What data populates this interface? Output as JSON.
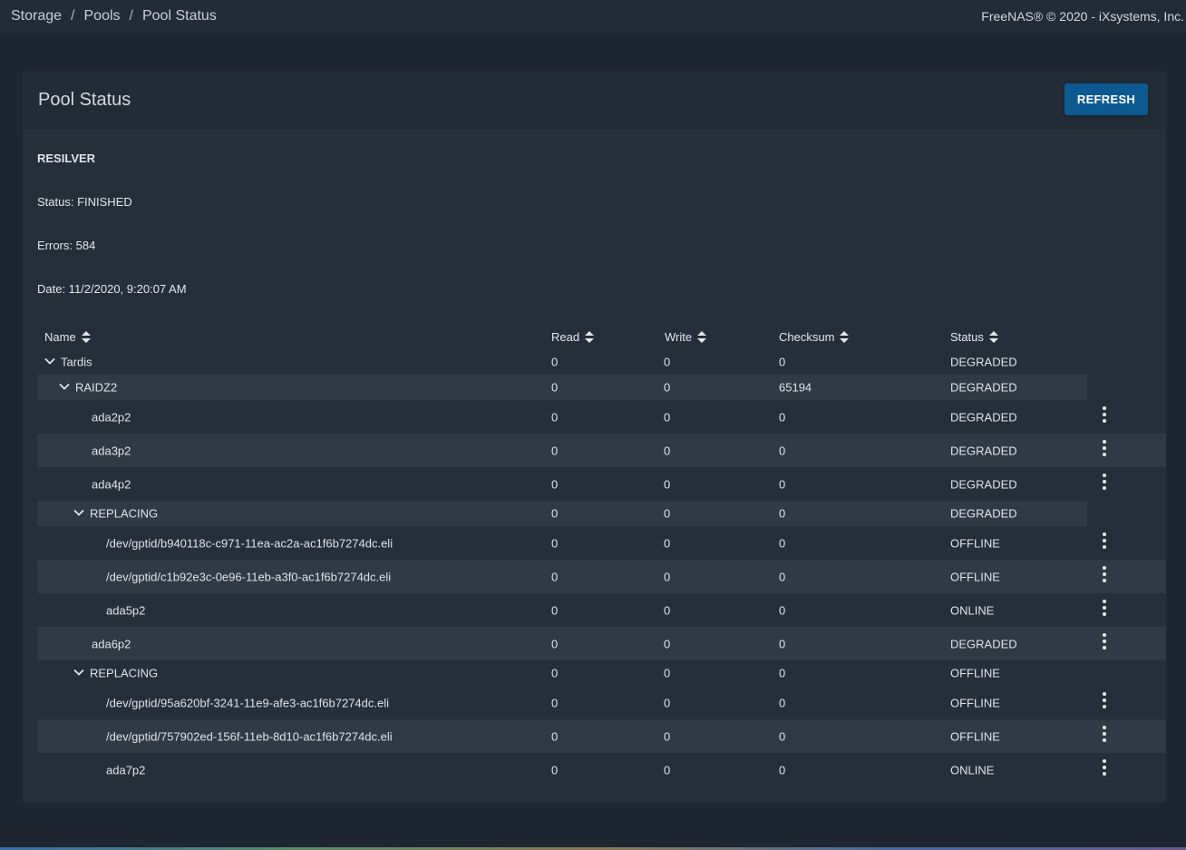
{
  "breadcrumb": {
    "items": [
      "Storage",
      "Pools",
      "Pool Status"
    ],
    "separator": "/"
  },
  "footer_notice": "FreeNAS® © 2020 - iXsystems, Inc.",
  "card": {
    "title": "Pool Status",
    "refresh_label": "REFRESH"
  },
  "scan": {
    "heading": "RESILVER",
    "status": "Status: FINISHED",
    "errors": "Errors: 584",
    "date": "Date: 11/2/2020, 9:20:07 AM"
  },
  "table": {
    "columns": [
      "Name",
      "Read",
      "Write",
      "Checksum",
      "Status"
    ],
    "rows": [
      {
        "name": "Tardis",
        "read": "0",
        "write": "0",
        "checksum": "0",
        "status": "DEGRADED",
        "kind": "group",
        "depth": 0
      },
      {
        "name": "RAIDZ2",
        "read": "0",
        "write": "0",
        "checksum": "65194",
        "status": "DEGRADED",
        "kind": "group",
        "depth": 1
      },
      {
        "name": "ada2p2",
        "read": "0",
        "write": "0",
        "checksum": "0",
        "status": "DEGRADED",
        "kind": "disk",
        "depth": 2
      },
      {
        "name": "ada3p2",
        "read": "0",
        "write": "0",
        "checksum": "0",
        "status": "DEGRADED",
        "kind": "disk",
        "depth": 2
      },
      {
        "name": "ada4p2",
        "read": "0",
        "write": "0",
        "checksum": "0",
        "status": "DEGRADED",
        "kind": "disk",
        "depth": 2
      },
      {
        "name": "REPLACING",
        "read": "0",
        "write": "0",
        "checksum": "0",
        "status": "DEGRADED",
        "kind": "group",
        "depth": 2
      },
      {
        "name": "/dev/gptid/b940118c-c971-11ea-ac2a-ac1f6b7274dc.eli",
        "read": "0",
        "write": "0",
        "checksum": "0",
        "status": "OFFLINE",
        "kind": "disk",
        "depth": 3
      },
      {
        "name": "/dev/gptid/c1b92e3c-0e96-11eb-a3f0-ac1f6b7274dc.eli",
        "read": "0",
        "write": "0",
        "checksum": "0",
        "status": "OFFLINE",
        "kind": "disk",
        "depth": 3
      },
      {
        "name": "ada5p2",
        "read": "0",
        "write": "0",
        "checksum": "0",
        "status": "ONLINE",
        "kind": "disk",
        "depth": 3
      },
      {
        "name": "ada6p2",
        "read": "0",
        "write": "0",
        "checksum": "0",
        "status": "DEGRADED",
        "kind": "disk",
        "depth": 2
      },
      {
        "name": "REPLACING",
        "read": "0",
        "write": "0",
        "checksum": "0",
        "status": "OFFLINE",
        "kind": "group",
        "depth": 2
      },
      {
        "name": "/dev/gptid/95a620bf-3241-11e9-afe3-ac1f6b7274dc.eli",
        "read": "0",
        "write": "0",
        "checksum": "0",
        "status": "OFFLINE",
        "kind": "disk",
        "depth": 3
      },
      {
        "name": "/dev/gptid/757902ed-156f-11eb-8d10-ac1f6b7274dc.eli",
        "read": "0",
        "write": "0",
        "checksum": "0",
        "status": "OFFLINE",
        "kind": "disk",
        "depth": 3
      },
      {
        "name": "ada7p2",
        "read": "0",
        "write": "0",
        "checksum": "0",
        "status": "ONLINE",
        "kind": "disk",
        "depth": 3
      }
    ]
  },
  "icons": {
    "sort": "sort-icon",
    "expand": "chevron-down-icon",
    "menu": "more-vert-icon"
  },
  "colors": {
    "background": "#1d2631",
    "card": "#252f3a",
    "row_alt": "#2f3a45",
    "button": "#0d5a93"
  }
}
